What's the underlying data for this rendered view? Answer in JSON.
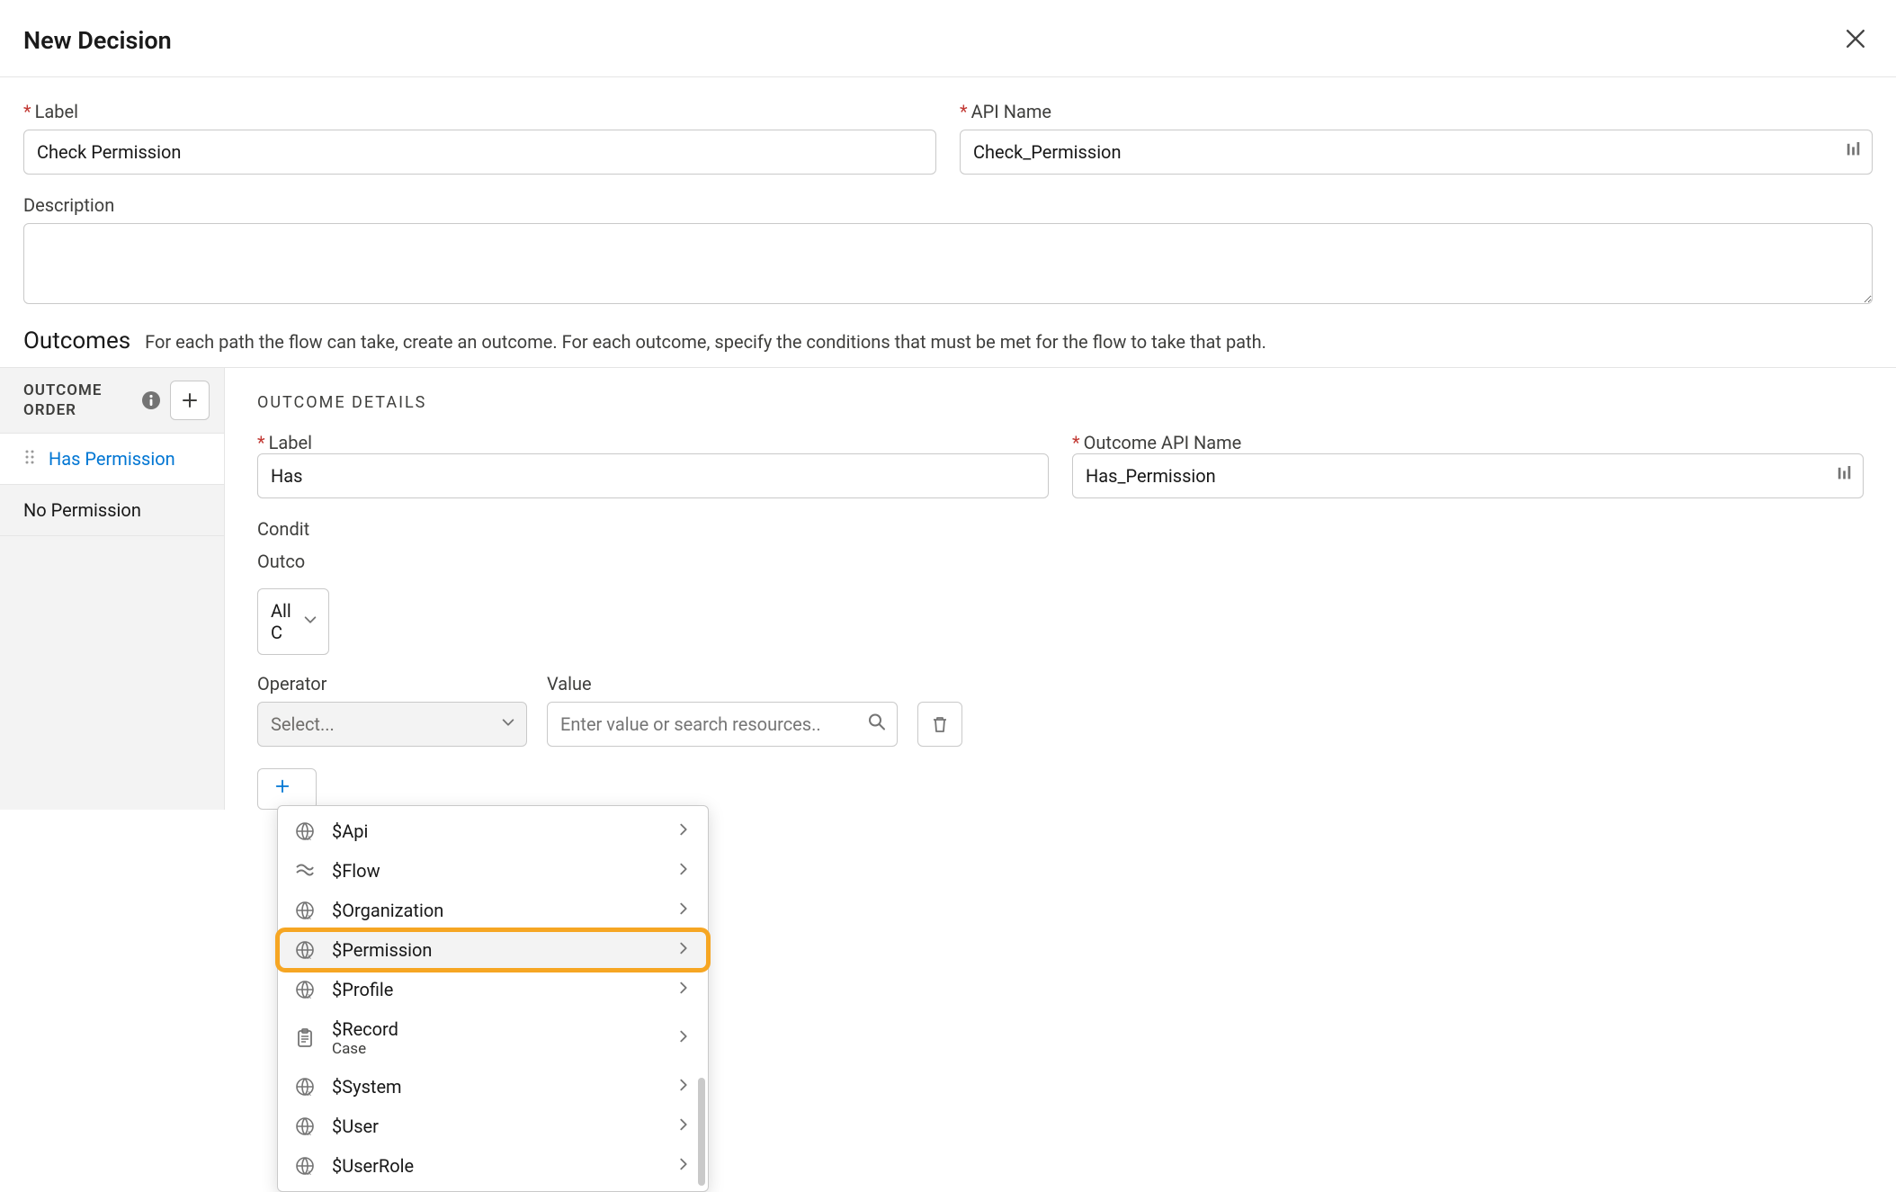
{
  "modal": {
    "title": "New Decision",
    "label_field_label": "Label",
    "label_value": "Check Permission",
    "api_name_label": "API Name",
    "api_name_value": "Check_Permission",
    "description_label": "Description",
    "description_value": ""
  },
  "outcomes": {
    "section_title": "Outcomes",
    "section_help": "For each path the flow can take, create an outcome. For each outcome, specify the conditions that must be met for the flow to take that path.",
    "order_title": "OUTCOME ORDER",
    "items": [
      {
        "label": "Has Permission"
      },
      {
        "label": "No Permission"
      }
    ]
  },
  "details": {
    "heading": "OUTCOME DETAILS",
    "label_label": "Label",
    "label_value": "Has",
    "api_label": "Outcome API Name",
    "api_value": "Has_Permission",
    "cond_req_label": "Condit",
    "cond_req_sub": "Outco",
    "cond_req_value": "All C",
    "operator_label": "Operator",
    "operator_placeholder": "Select...",
    "value_label": "Value",
    "value_placeholder": "Enter value or search resources..",
    "add_condition_label": ""
  },
  "dropdown": {
    "items": [
      {
        "label": "$Api",
        "icon": "globe"
      },
      {
        "label": "$Flow",
        "icon": "flow"
      },
      {
        "label": "$Organization",
        "icon": "globe"
      },
      {
        "label": "$Permission",
        "icon": "globe",
        "highlighted": true,
        "hovered": true
      },
      {
        "label": "$Profile",
        "icon": "globe"
      },
      {
        "label": "$Record",
        "sub": "Case",
        "icon": "clipboard"
      },
      {
        "label": "$System",
        "icon": "globe"
      },
      {
        "label": "$User",
        "icon": "globe"
      },
      {
        "label": "$UserRole",
        "icon": "globe"
      }
    ]
  }
}
